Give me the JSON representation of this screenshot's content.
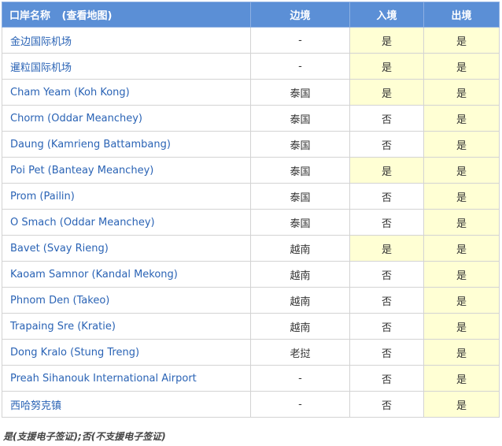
{
  "header": {
    "name": "口岸名称",
    "map_link": "(查看地图)",
    "border": "边境",
    "entry": "入境",
    "exit": "出境"
  },
  "rows": [
    {
      "name": "金边国际机场",
      "border": "-",
      "entry": "是",
      "exit": "是"
    },
    {
      "name": "暹粒国际机场",
      "border": "-",
      "entry": "是",
      "exit": "是"
    },
    {
      "name": "Cham Yeam (Koh Kong)",
      "border": "泰国",
      "entry": "是",
      "exit": "是"
    },
    {
      "name": "Chorm (Oddar Meanchey)",
      "border": "泰国",
      "entry": "否",
      "exit": "是"
    },
    {
      "name": "Daung (Kamrieng Battambang)",
      "border": "泰国",
      "entry": "否",
      "exit": "是"
    },
    {
      "name": "Poi Pet (Banteay Meanchey)",
      "border": "泰国",
      "entry": "是",
      "exit": "是"
    },
    {
      "name": "Prom (Pailin)",
      "border": "泰国",
      "entry": "否",
      "exit": "是"
    },
    {
      "name": "O Smach (Oddar Meanchey)",
      "border": "泰国",
      "entry": "否",
      "exit": "是"
    },
    {
      "name": "Bavet (Svay Rieng)",
      "border": "越南",
      "entry": "是",
      "exit": "是"
    },
    {
      "name": "Kaoam Samnor (Kandal Mekong)",
      "border": "越南",
      "entry": "否",
      "exit": "是"
    },
    {
      "name": "Phnom Den (Takeo)",
      "border": "越南",
      "entry": "否",
      "exit": "是"
    },
    {
      "name": "Trapaing Sre (Kratie)",
      "border": "越南",
      "entry": "否",
      "exit": "是"
    },
    {
      "name": "Dong Kralo (Stung Treng)",
      "border": "老挝",
      "entry": "否",
      "exit": "是"
    },
    {
      "name": "Preah Sihanouk International Airport",
      "border": "-",
      "entry": "否",
      "exit": "是"
    },
    {
      "name": "西哈努克镇",
      "border": "-",
      "entry": "否",
      "exit": "是"
    }
  ],
  "footnote": "是(支援电子签证);否(不支援电子签证)",
  "colors": {
    "header_bg": "#5b8fd6",
    "yes_bg": "#ffffd4",
    "link": "#2a63b5"
  }
}
